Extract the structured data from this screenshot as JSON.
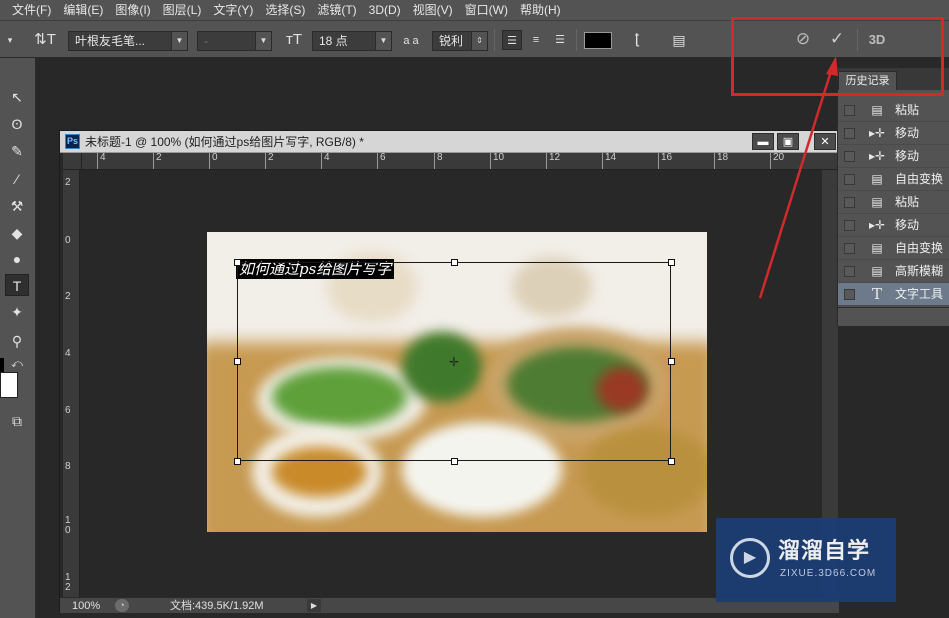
{
  "menubar": {
    "items": [
      "文件(F)",
      "编辑(E)",
      "图像(I)",
      "图层(L)",
      "文字(Y)",
      "选择(S)",
      "滤镜(T)",
      "3D(D)",
      "视图(V)",
      "窗口(W)",
      "帮助(H)"
    ]
  },
  "options": {
    "font_family": "叶根友毛笔...",
    "font_style": "-",
    "font_size": "18 点",
    "antialias_icon_text": "a a",
    "antialias": "锐利",
    "three_d_label": "3D",
    "text_color": "#000000"
  },
  "document": {
    "ps_badge": "Ps",
    "title": "未标题-1 @ 100% (如何通过ps给图片写字, RGB/8) *",
    "zoom": "100%",
    "doc_info": "文档:439.5K/1.92M",
    "ruler_h": [
      "4",
      "2",
      "0",
      "2",
      "4",
      "6",
      "8",
      "10",
      "12",
      "14",
      "16",
      "18",
      "20"
    ],
    "ruler_v": [
      "2",
      "0",
      "2",
      "4",
      "6",
      "8",
      "1\n0",
      "1\n2"
    ],
    "canvas_text": "如何通过ps给图片写字"
  },
  "history": {
    "tab_label": "历史记录",
    "items": [
      {
        "label": "粘贴",
        "icon": "doc-icon"
      },
      {
        "label": "移动",
        "icon": "move-icon"
      },
      {
        "label": "移动",
        "icon": "move-icon"
      },
      {
        "label": "自由变换",
        "icon": "doc-icon"
      },
      {
        "label": "粘贴",
        "icon": "doc-icon"
      },
      {
        "label": "移动",
        "icon": "move-icon"
      },
      {
        "label": "自由变换",
        "icon": "doc-icon"
      },
      {
        "label": "高斯模糊",
        "icon": "doc-icon"
      },
      {
        "label": "文字工具",
        "icon": "type-icon"
      }
    ],
    "selected_index": 8
  },
  "watermark": {
    "title": "溜溜自学",
    "url": "ZIXUE.3D66.COM"
  },
  "colors": {
    "annotation_red": "#d12a2a",
    "selected_row": "#6c7a8c"
  }
}
